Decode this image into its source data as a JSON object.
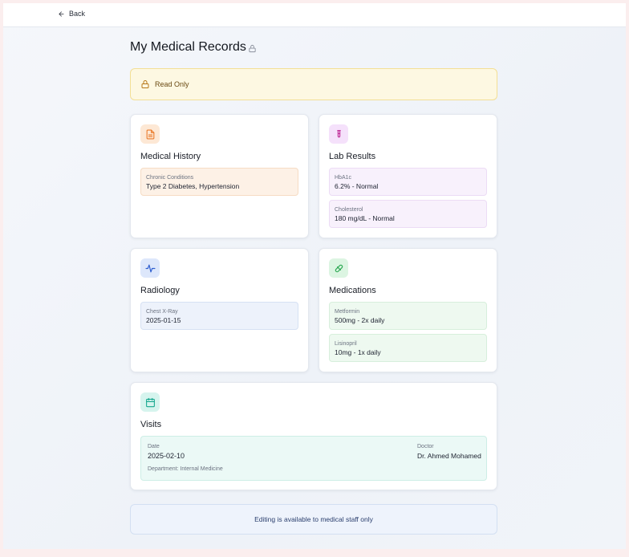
{
  "nav": {
    "back_label": "Back"
  },
  "page": {
    "title": "My Medical Records"
  },
  "banner": {
    "read_only_label": "Read Only"
  },
  "medical_history": {
    "title": "Medical History",
    "fields": [
      {
        "label": "Chronic Conditions",
        "value": "Type 2 Diabetes, Hypertension"
      }
    ]
  },
  "lab_results": {
    "title": "Lab Results",
    "fields": [
      {
        "label": "HbA1c",
        "value": "6.2% - Normal"
      },
      {
        "label": "Cholesterol",
        "value": "180 mg/dL - Normal"
      }
    ]
  },
  "radiology": {
    "title": "Radiology",
    "fields": [
      {
        "label": "Chest X-Ray",
        "value": "2025-01-15"
      }
    ]
  },
  "medications": {
    "title": "Medications",
    "fields": [
      {
        "label": "Metformin",
        "value": "500mg - 2x daily"
      },
      {
        "label": "Lisinopril",
        "value": "10mg - 1x daily"
      }
    ]
  },
  "visits": {
    "title": "Visits",
    "date_label": "Date",
    "date_value": "2025-02-10",
    "doctor_label": "Doctor",
    "doctor_value": "Dr. Ahmed Mohamed",
    "department": "Department: Internal Medicine"
  },
  "footer_notice": "Editing is available to medical staff only",
  "icons": {
    "back": "arrow-left-icon",
    "title_lock": "lock-icon",
    "banner_lock": "lock-icon",
    "medical_history": "file-text-icon",
    "lab_results": "test-tube-icon",
    "radiology": "activity-icon",
    "medications": "pill-icon",
    "visits": "calendar-icon"
  },
  "colors": {
    "orange": "#ea7a2a",
    "purple": "#b53ad6",
    "blue": "#2f5fd0",
    "green": "#2faa55",
    "teal": "#17a88f"
  }
}
